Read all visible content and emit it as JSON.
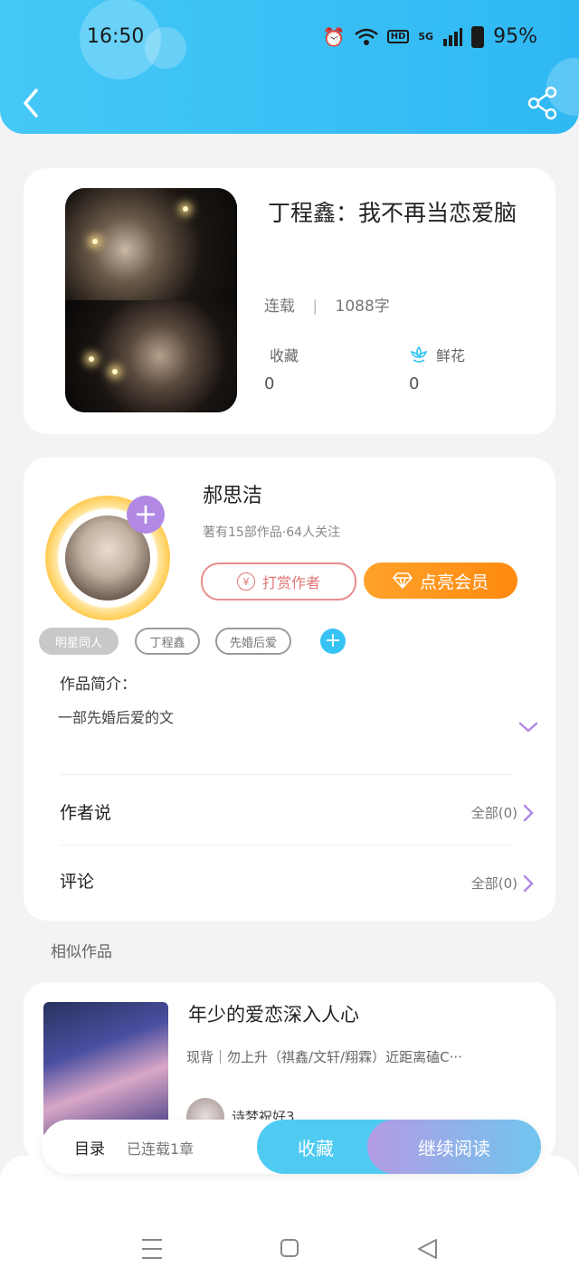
{
  "status_bar": {
    "time": "16:50",
    "battery": "95%",
    "network": "5G"
  },
  "colors": {
    "accent": "#35c3f3",
    "header": "#45c8f6",
    "vip": "#ff8a10",
    "purple": "#b189e4"
  },
  "book": {
    "title": "丁程鑫：我不再当恋爱脑",
    "status": "连载",
    "word_count": "1088字",
    "collect_label": "收藏",
    "collect_count": "0",
    "flower_label": "鲜花",
    "flower_count": "0"
  },
  "author": {
    "name": "郝思洁",
    "stats": "著有15部作品·64人关注",
    "tip_label": "打赏作者",
    "vip_label": "点亮会员",
    "tags": [
      "明星同人",
      "丁程鑫",
      "先婚后爱"
    ]
  },
  "intro": {
    "label": "作品简介：",
    "text": "一部先婚后爱的文"
  },
  "rows": {
    "author_says": {
      "label": "作者说",
      "count": "全部(0)"
    },
    "comments": {
      "label": "评论",
      "count": "全部(0)"
    }
  },
  "similar": {
    "section_title": "相似作品",
    "item": {
      "title": "年少的爱恋深入人心",
      "desc": "现背｜勿上升（祺鑫/文轩/翔霖）近距离磕C···",
      "author": "诗梦祝好3"
    }
  },
  "bottom_bar": {
    "toc_label": "目录",
    "toc_status": "已连载1章",
    "collect_label": "收藏",
    "read_label": "继续阅读"
  },
  "icons": [
    "back-icon",
    "share-icon",
    "flower-icon",
    "yen-icon",
    "diamond-icon",
    "chevron-down-icon",
    "chevron-right-icon",
    "menu-icon",
    "home-icon",
    "back-triangle-icon"
  ]
}
